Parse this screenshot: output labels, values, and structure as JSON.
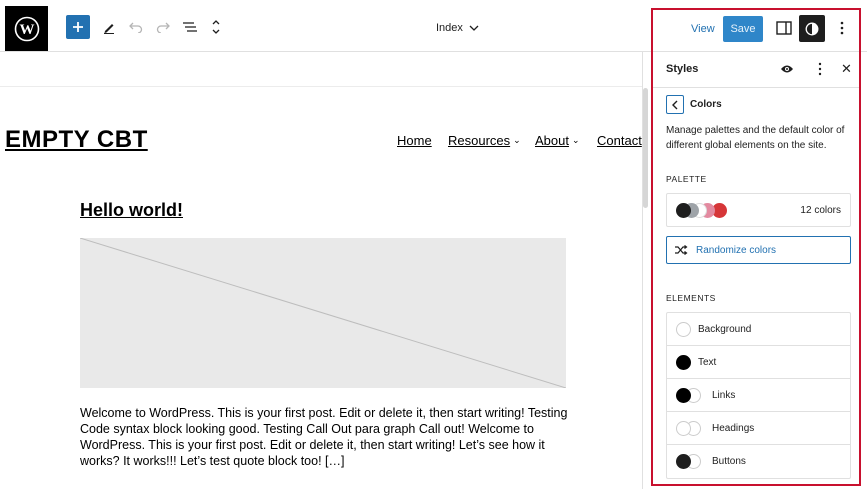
{
  "toolbar": {
    "document_title": "Index",
    "view_label": "View",
    "save_label": "Save",
    "icons": [
      "wordpress-icon",
      "add-block-icon",
      "pencil-icon",
      "undo-icon",
      "redo-icon",
      "list-view-icon",
      "chevron-up-down-icon",
      "sidebar-toggle-icon",
      "styles-contrast-icon",
      "options-icon"
    ]
  },
  "canvas": {
    "site_title": "EMPTY CBT",
    "nav": [
      {
        "label": "Home",
        "has_submenu": false
      },
      {
        "label": "Resources",
        "has_submenu": true
      },
      {
        "label": "About",
        "has_submenu": true
      },
      {
        "label": "Contact",
        "has_submenu": false
      }
    ],
    "post_title": "Hello world!",
    "excerpt": "Welcome to WordPress. This is your first post. Edit or delete it, then start writing! Testing Code syntax block looking good. Testing Call Out para graph Call out! Welcome to WordPress. This is your first post. Edit or delete it, then start writing! Let’s see how it works? It works!!! Let’s test quote block too! […]"
  },
  "styles_panel": {
    "title": "Styles",
    "subtitle": "Colors",
    "description": "Manage palettes and the default color of different global elements on the site.",
    "palette_label": "PALETTE",
    "palette_count": "12 colors",
    "palette_swatches": [
      "#1e1e1e",
      "#9ea3a8",
      "#ffffff",
      "#e38aa0",
      "#d63638"
    ],
    "randomize_label": "Randomize colors",
    "elements_label": "ELEMENTS",
    "elements": [
      {
        "label": "Background",
        "style": "single",
        "colors": [
          "#ffffff"
        ]
      },
      {
        "label": "Text",
        "style": "single",
        "colors": [
          "#000000"
        ]
      },
      {
        "label": "Links",
        "style": "pair",
        "colors": [
          "#000000",
          "#ffffff"
        ]
      },
      {
        "label": "Headings",
        "style": "pair",
        "colors": [
          "#ffffff",
          "#ffffff"
        ]
      },
      {
        "label": "Buttons",
        "style": "pair",
        "colors": [
          "#1e1e1e",
          "#ffffff"
        ]
      }
    ],
    "highlight_color": "#c8102e",
    "accent_color": "#2271b1"
  }
}
